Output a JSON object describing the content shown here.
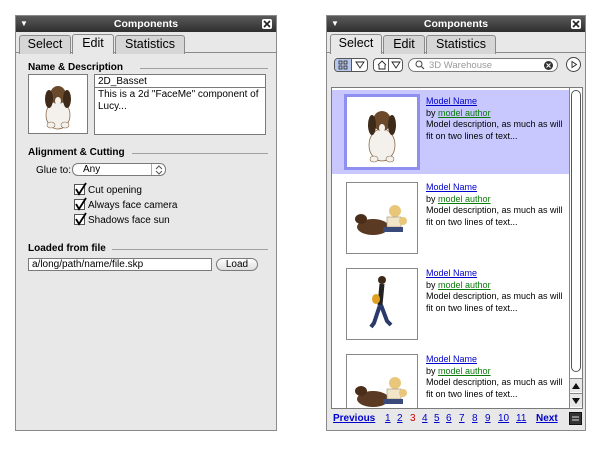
{
  "edit_panel": {
    "title": "Components",
    "tabs": [
      "Select",
      "Edit",
      "Statistics"
    ],
    "name_section": "Name & Description",
    "name_value": "2D_Basset",
    "description_value": "This is a 2d \"FaceMe\" component of Lucy...",
    "alignment_section": "Alignment & Cutting",
    "glue_label": "Glue to:",
    "glue_value": "Any",
    "checkboxes": [
      {
        "label": "Cut opening",
        "checked": true
      },
      {
        "label": "Always face camera",
        "checked": true
      },
      {
        "label": "Shadows face sun",
        "checked": true
      }
    ],
    "loaded_section": "Loaded from file",
    "path_value": "a/long/path/name/file.skp",
    "load_button": "Load"
  },
  "select_panel": {
    "title": "Components",
    "tabs": [
      "Select",
      "Edit",
      "Statistics"
    ],
    "search_placeholder": "3D Warehouse",
    "items": [
      {
        "name": "Model Name",
        "by": "by",
        "author": "model author",
        "description": "Model description, as much as will fit on two lines of text...",
        "thumb": "dog-icon"
      },
      {
        "name": "Model Name",
        "by": "by",
        "author": "model author",
        "description": "Model description, as much as will fit on two lines of text...",
        "thumb": "kids-dog-icon"
      },
      {
        "name": "Model Name",
        "by": "by",
        "author": "model author",
        "description": "Model description, as much as will fit on two lines of text...",
        "thumb": "walking-person-icon"
      },
      {
        "name": "Model Name",
        "by": "by",
        "author": "model author",
        "description": "Model description, as much as will fit on two lines of text...",
        "thumb": "kids-dog-icon"
      }
    ],
    "pager": {
      "previous": "Previous",
      "pages": [
        "1",
        "2",
        "3",
        "4",
        "5",
        "6",
        "7",
        "8",
        "9",
        "10",
        "11"
      ],
      "current": "3",
      "next": "Next"
    }
  },
  "colors": {
    "selected_row": "#c8c8ff",
    "link": "#0000cc",
    "author_link": "#0a7a0a",
    "current_page": "#cc0000"
  }
}
